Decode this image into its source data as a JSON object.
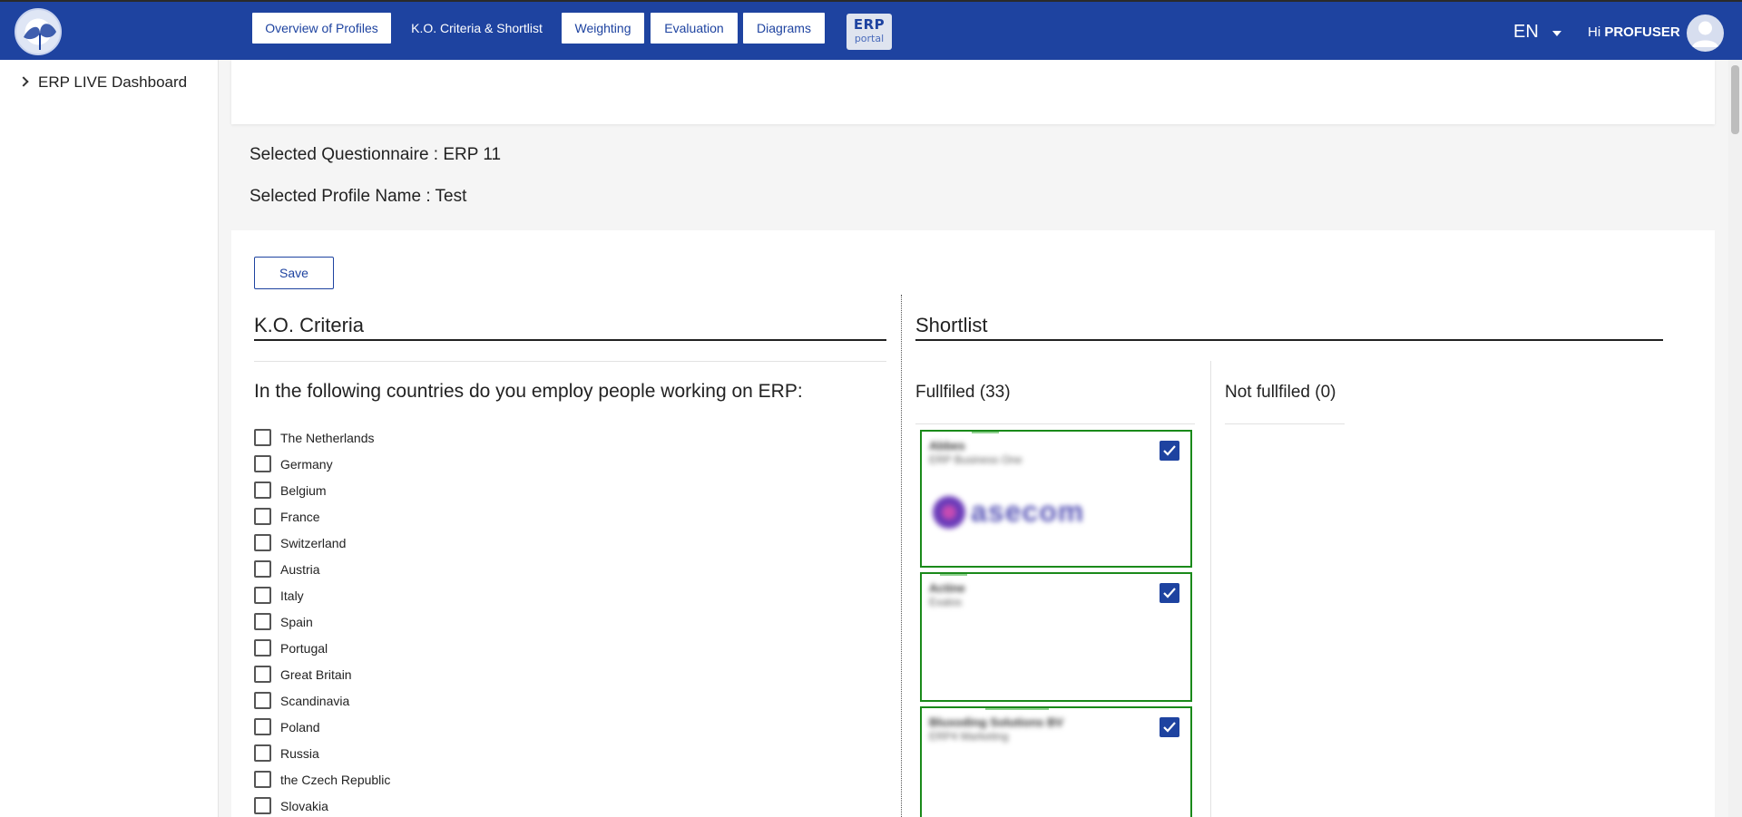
{
  "header": {
    "logo_name": "leaf-globe-logo",
    "app_badge": {
      "line1": "ERP",
      "line2": "portal"
    },
    "language": "EN",
    "greeting_prefix": "Hi",
    "username": "PROFUSER"
  },
  "sidebar": {
    "items": [
      {
        "label": "ERP LIVE Dashboard"
      }
    ]
  },
  "tabs": [
    {
      "label": "Overview of Profiles",
      "active": false
    },
    {
      "label": "K.O. Criteria & Shortlist",
      "active": true
    },
    {
      "label": "Weighting",
      "active": false
    },
    {
      "label": "Evaluation",
      "active": false
    },
    {
      "label": "Diagrams",
      "active": false
    }
  ],
  "selected": {
    "questionnaire": "Selected Questionnaire : ERP 11",
    "profile": "Selected Profile Name : Test"
  },
  "actions": {
    "save_label": "Save"
  },
  "ko": {
    "title": "K.O. Criteria",
    "question": "In the following countries do you employ people working on ERP:",
    "countries": [
      {
        "label": "The Netherlands",
        "checked": false
      },
      {
        "label": "Germany",
        "checked": false
      },
      {
        "label": "Belgium",
        "checked": false
      },
      {
        "label": "France",
        "checked": false
      },
      {
        "label": "Switzerland",
        "checked": false
      },
      {
        "label": "Austria",
        "checked": false
      },
      {
        "label": "Italy",
        "checked": false
      },
      {
        "label": "Spain",
        "checked": false
      },
      {
        "label": "Portugal",
        "checked": false
      },
      {
        "label": "Great Britain",
        "checked": false
      },
      {
        "label": "Scandinavia",
        "checked": false
      },
      {
        "label": "Poland",
        "checked": false
      },
      {
        "label": "Russia",
        "checked": false
      },
      {
        "label": "the Czech Republic",
        "checked": false
      },
      {
        "label": "Slovakia",
        "checked": false
      }
    ]
  },
  "shortlist": {
    "title": "Shortlist",
    "fulfilled_label": "Fullfiled (33)",
    "not_fulfilled_label": "Not fullfiled (0)",
    "cards": [
      {
        "name": "Abbes",
        "sub": "ERP Business One",
        "logo_text": "asecom",
        "checked": true
      },
      {
        "name": "Actine",
        "sub": "Exalos",
        "logo_text": "",
        "checked": true
      },
      {
        "name": "Bluxoding Solutions BV",
        "sub": "ERP4 Marketing",
        "logo_text": "",
        "checked": true
      }
    ]
  },
  "colors": {
    "primary": "#1e43a0",
    "card_border": "#1a8a1a"
  }
}
